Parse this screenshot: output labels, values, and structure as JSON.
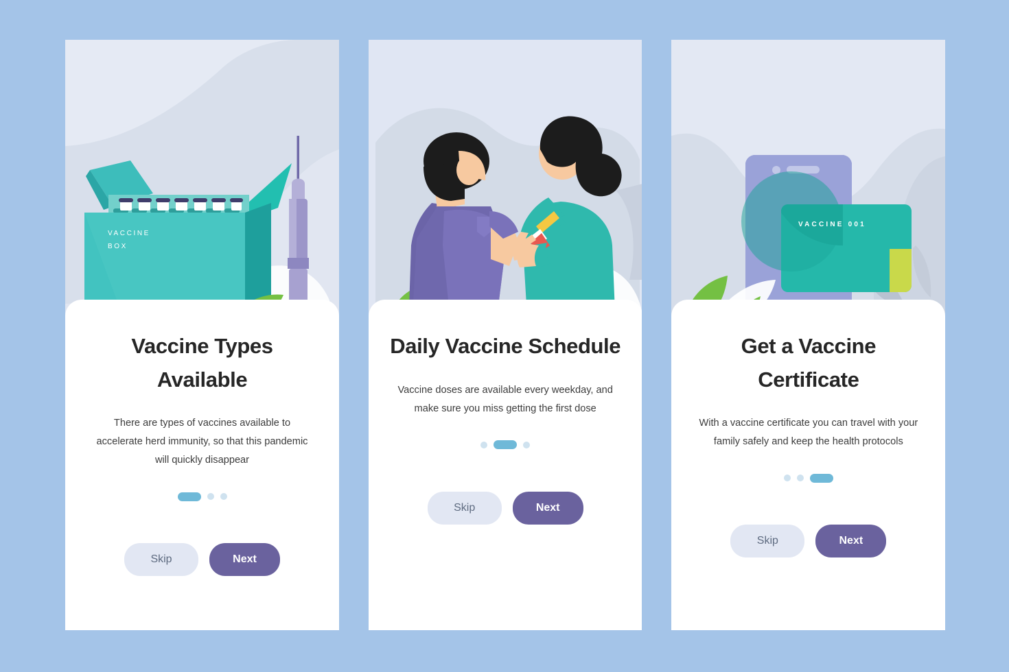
{
  "theme": {
    "page_background": "#a4c4e8",
    "panel_background": "#ffffff",
    "illustration_background": "#e3e8f3",
    "accent_teal": "#2cb5ae",
    "accent_purple": "#6a629e",
    "dot_active": "#6fb9d8",
    "dot_inactive": "#cfe2ef",
    "skip_button": "#e2e7f3",
    "title_color": "#262626"
  },
  "screens": [
    {
      "id": "vaccine-types",
      "illustration": "vaccine-box-and-syringe",
      "illustration_label_line1": "VACCINE",
      "illustration_label_line2": "BOX",
      "title": "Vaccine Types Available",
      "description": "There are types of vaccines available to accelerate herd immunity, so that this pandemic will quickly disappear",
      "dots": [
        "active",
        "inactive",
        "inactive"
      ],
      "skip_label": "Skip",
      "next_label": "Next"
    },
    {
      "id": "daily-schedule",
      "illustration": "nurse-vaccinating-patient",
      "title": "Daily Vaccine Schedule",
      "description": "Vaccine doses are available every weekday, and make sure you miss getting the first dose",
      "dots": [
        "inactive",
        "active",
        "inactive"
      ],
      "skip_label": "Skip",
      "next_label": "Next"
    },
    {
      "id": "vaccine-certificate",
      "illustration": "phone-with-vaccine-card",
      "card_label": "VACCINE 001",
      "title": "Get a Vaccine Certificate",
      "description": "With a vaccine certificate you can travel with your family safely and keep the health protocols",
      "dots": [
        "inactive",
        "inactive",
        "active"
      ],
      "skip_label": "Skip",
      "next_label": "Next"
    }
  ]
}
